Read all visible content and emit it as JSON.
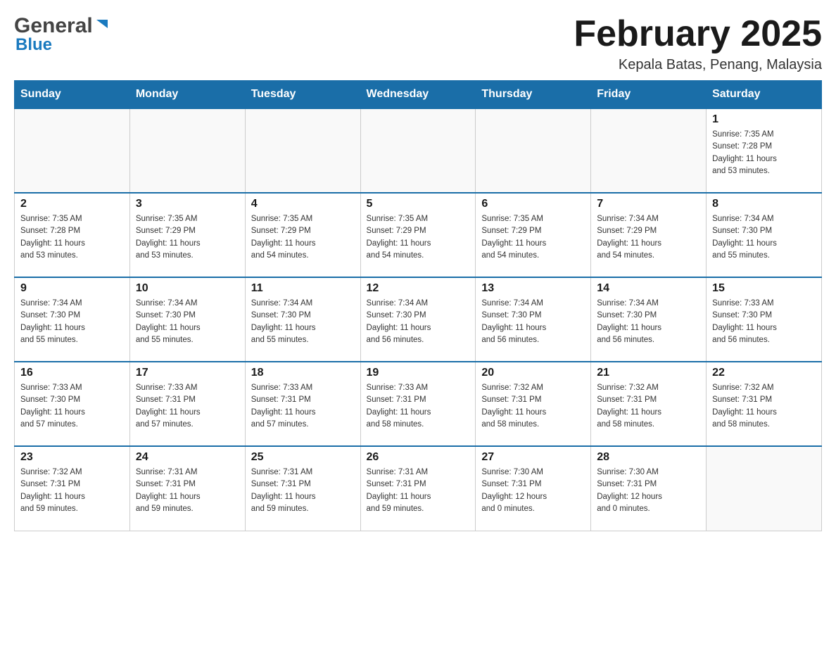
{
  "header": {
    "logo_general": "General",
    "logo_blue": "Blue",
    "month_title": "February 2025",
    "location": "Kepala Batas, Penang, Malaysia"
  },
  "days_of_week": [
    "Sunday",
    "Monday",
    "Tuesday",
    "Wednesday",
    "Thursday",
    "Friday",
    "Saturday"
  ],
  "weeks": [
    {
      "days": [
        {
          "number": "",
          "info": "",
          "empty": true
        },
        {
          "number": "",
          "info": "",
          "empty": true
        },
        {
          "number": "",
          "info": "",
          "empty": true
        },
        {
          "number": "",
          "info": "",
          "empty": true
        },
        {
          "number": "",
          "info": "",
          "empty": true
        },
        {
          "number": "",
          "info": "",
          "empty": true
        },
        {
          "number": "1",
          "info": "Sunrise: 7:35 AM\nSunset: 7:28 PM\nDaylight: 11 hours\nand 53 minutes."
        }
      ]
    },
    {
      "days": [
        {
          "number": "2",
          "info": "Sunrise: 7:35 AM\nSunset: 7:28 PM\nDaylight: 11 hours\nand 53 minutes."
        },
        {
          "number": "3",
          "info": "Sunrise: 7:35 AM\nSunset: 7:29 PM\nDaylight: 11 hours\nand 53 minutes."
        },
        {
          "number": "4",
          "info": "Sunrise: 7:35 AM\nSunset: 7:29 PM\nDaylight: 11 hours\nand 54 minutes."
        },
        {
          "number": "5",
          "info": "Sunrise: 7:35 AM\nSunset: 7:29 PM\nDaylight: 11 hours\nand 54 minutes."
        },
        {
          "number": "6",
          "info": "Sunrise: 7:35 AM\nSunset: 7:29 PM\nDaylight: 11 hours\nand 54 minutes."
        },
        {
          "number": "7",
          "info": "Sunrise: 7:34 AM\nSunset: 7:29 PM\nDaylight: 11 hours\nand 54 minutes."
        },
        {
          "number": "8",
          "info": "Sunrise: 7:34 AM\nSunset: 7:30 PM\nDaylight: 11 hours\nand 55 minutes."
        }
      ]
    },
    {
      "days": [
        {
          "number": "9",
          "info": "Sunrise: 7:34 AM\nSunset: 7:30 PM\nDaylight: 11 hours\nand 55 minutes."
        },
        {
          "number": "10",
          "info": "Sunrise: 7:34 AM\nSunset: 7:30 PM\nDaylight: 11 hours\nand 55 minutes."
        },
        {
          "number": "11",
          "info": "Sunrise: 7:34 AM\nSunset: 7:30 PM\nDaylight: 11 hours\nand 55 minutes."
        },
        {
          "number": "12",
          "info": "Sunrise: 7:34 AM\nSunset: 7:30 PM\nDaylight: 11 hours\nand 56 minutes."
        },
        {
          "number": "13",
          "info": "Sunrise: 7:34 AM\nSunset: 7:30 PM\nDaylight: 11 hours\nand 56 minutes."
        },
        {
          "number": "14",
          "info": "Sunrise: 7:34 AM\nSunset: 7:30 PM\nDaylight: 11 hours\nand 56 minutes."
        },
        {
          "number": "15",
          "info": "Sunrise: 7:33 AM\nSunset: 7:30 PM\nDaylight: 11 hours\nand 56 minutes."
        }
      ]
    },
    {
      "days": [
        {
          "number": "16",
          "info": "Sunrise: 7:33 AM\nSunset: 7:30 PM\nDaylight: 11 hours\nand 57 minutes."
        },
        {
          "number": "17",
          "info": "Sunrise: 7:33 AM\nSunset: 7:31 PM\nDaylight: 11 hours\nand 57 minutes."
        },
        {
          "number": "18",
          "info": "Sunrise: 7:33 AM\nSunset: 7:31 PM\nDaylight: 11 hours\nand 57 minutes."
        },
        {
          "number": "19",
          "info": "Sunrise: 7:33 AM\nSunset: 7:31 PM\nDaylight: 11 hours\nand 58 minutes."
        },
        {
          "number": "20",
          "info": "Sunrise: 7:32 AM\nSunset: 7:31 PM\nDaylight: 11 hours\nand 58 minutes."
        },
        {
          "number": "21",
          "info": "Sunrise: 7:32 AM\nSunset: 7:31 PM\nDaylight: 11 hours\nand 58 minutes."
        },
        {
          "number": "22",
          "info": "Sunrise: 7:32 AM\nSunset: 7:31 PM\nDaylight: 11 hours\nand 58 minutes."
        }
      ]
    },
    {
      "days": [
        {
          "number": "23",
          "info": "Sunrise: 7:32 AM\nSunset: 7:31 PM\nDaylight: 11 hours\nand 59 minutes."
        },
        {
          "number": "24",
          "info": "Sunrise: 7:31 AM\nSunset: 7:31 PM\nDaylight: 11 hours\nand 59 minutes."
        },
        {
          "number": "25",
          "info": "Sunrise: 7:31 AM\nSunset: 7:31 PM\nDaylight: 11 hours\nand 59 minutes."
        },
        {
          "number": "26",
          "info": "Sunrise: 7:31 AM\nSunset: 7:31 PM\nDaylight: 11 hours\nand 59 minutes."
        },
        {
          "number": "27",
          "info": "Sunrise: 7:30 AM\nSunset: 7:31 PM\nDaylight: 12 hours\nand 0 minutes."
        },
        {
          "number": "28",
          "info": "Sunrise: 7:30 AM\nSunset: 7:31 PM\nDaylight: 12 hours\nand 0 minutes."
        },
        {
          "number": "",
          "info": "",
          "empty": true
        }
      ]
    }
  ]
}
